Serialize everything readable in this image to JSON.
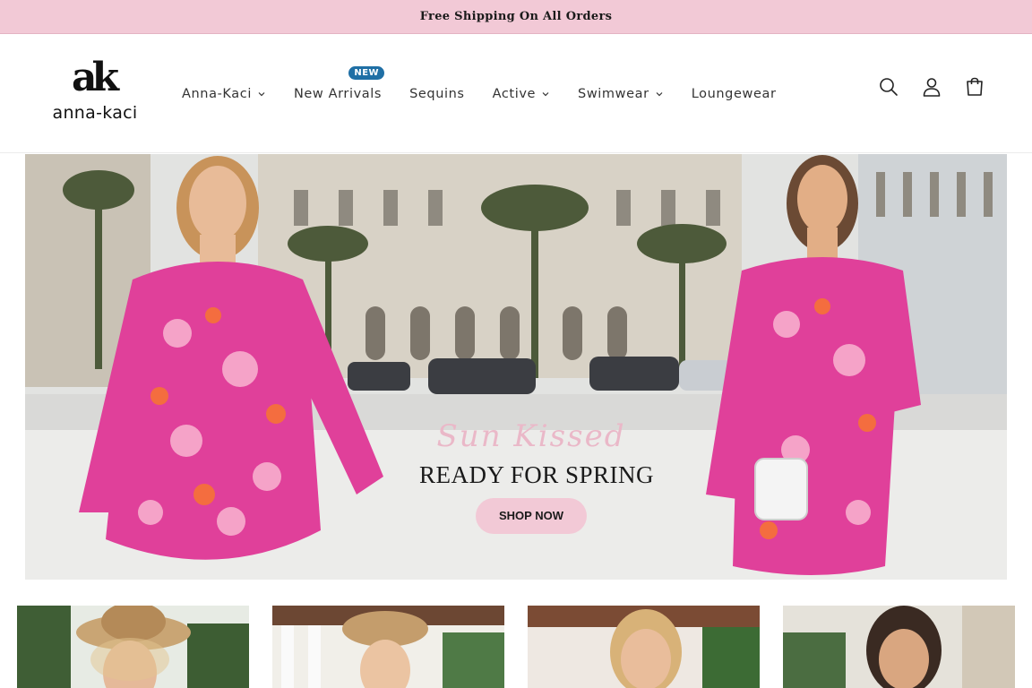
{
  "announcement": {
    "text": "Free Shipping On All Orders"
  },
  "brand": {
    "mark": "ak",
    "name": "anna-kaci"
  },
  "nav": {
    "items": [
      {
        "label": "Anna-Kaci",
        "has_dropdown": true
      },
      {
        "label": "New Arrivals",
        "badge": "NEW"
      },
      {
        "label": "Sequins"
      },
      {
        "label": "Active",
        "has_dropdown": true
      },
      {
        "label": "Swimwear",
        "has_dropdown": true
      },
      {
        "label": "Loungewear"
      }
    ]
  },
  "header_icons": [
    "search-icon",
    "account-icon",
    "cart-icon"
  ],
  "hero": {
    "script_text": "Sun Kissed",
    "heading": "READY FOR SPRING",
    "cta_label": "SHOP NOW"
  },
  "colors": {
    "announcement_bg": "#f2c9d6",
    "cta_bg": "#f2c9d6",
    "badge_bg": "#1f6fa5",
    "script_pink": "#eab8c8"
  }
}
